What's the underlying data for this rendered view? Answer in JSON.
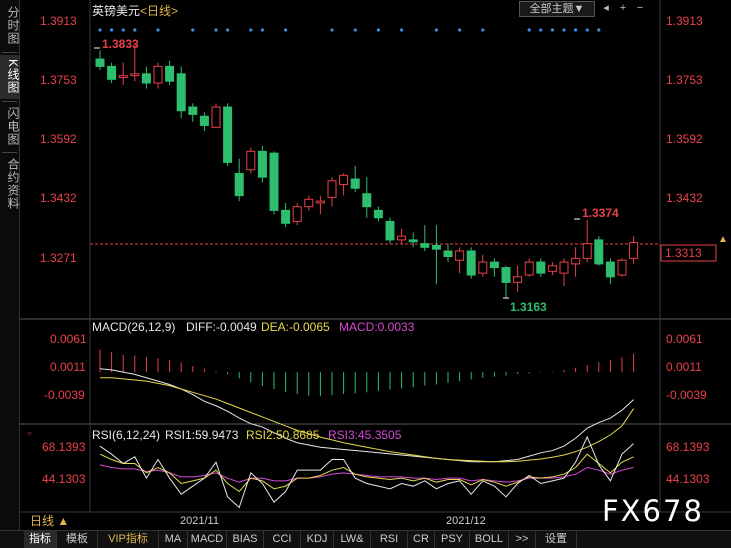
{
  "sidebar": {
    "tabs": [
      {
        "label": "分时图",
        "active": false
      },
      {
        "label": "K线图",
        "active": true
      },
      {
        "label": "闪电图",
        "active": false
      },
      {
        "label": "合约资料",
        "active": false
      }
    ]
  },
  "topbar": {
    "symbol": "英镑美元",
    "period": "<日线>",
    "theme_label": "全部主题▼",
    "icons": [
      "back-icon",
      "plus-icon",
      "minus-icon"
    ]
  },
  "price_panel": {
    "axis_labels": [
      "1.3913",
      "1.3753",
      "1.3592",
      "1.3432",
      "1.3271"
    ],
    "last_price": "1.3313",
    "high_label": "1.3833",
    "low_label": "1.3163",
    "local_high_label": "1.3374"
  },
  "macd_panel": {
    "title": "MACD(26,12,9)",
    "diff_label": "DIFF:-0.0049",
    "dea_label": "DEA:-0.0065",
    "macd_label": "MACD:0.0033",
    "axis_labels": [
      "0.0061",
      "0.0011",
      "-0.0039"
    ]
  },
  "rsi_panel": {
    "title": "RSI(6,12,24)",
    "rsi1_label": "RSI1:59.9473",
    "rsi2_label": "RSI2:50.8685",
    "rsi3_label": "RSI3:45.3505",
    "axis_labels": [
      "68.1393",
      "44.1303"
    ]
  },
  "time_labels": [
    "2021/11",
    "2021/12"
  ],
  "period_button": "日线 ▲",
  "bottom_tabs": [
    {
      "label": "指标",
      "active": true
    },
    {
      "label": "模板",
      "active": false
    },
    {
      "label": "VIP指标",
      "active": false,
      "vip": true
    },
    {
      "label": "MA"
    },
    {
      "label": "MACD"
    },
    {
      "label": "BIAS"
    },
    {
      "label": "CCI"
    },
    {
      "label": "KDJ"
    },
    {
      "label": "LW&"
    },
    {
      "label": "RSI"
    },
    {
      "label": "CR"
    },
    {
      "label": "PSY"
    },
    {
      "label": "BOLL"
    },
    {
      "label": ">>"
    },
    {
      "label": "设置"
    }
  ],
  "watermark": "FX678",
  "colors": {
    "up": "#e8414a",
    "down": "#2dbf6e",
    "diff": "#e8e8e8",
    "dea": "#e6d94a",
    "macd": "#d64ad6",
    "dash": "#e8414a"
  },
  "chart_data": {
    "type": "candlestick",
    "title": "英镑美元 <日线>",
    "ylim": [
      1.3163,
      1.3913
    ],
    "candles": [
      {
        "o": 1.381,
        "h": 1.3833,
        "l": 1.378,
        "c": 1.379
      },
      {
        "o": 1.379,
        "h": 1.38,
        "l": 1.3745,
        "c": 1.3755
      },
      {
        "o": 1.376,
        "h": 1.38,
        "l": 1.374,
        "c": 1.3765
      },
      {
        "o": 1.3765,
        "h": 1.385,
        "l": 1.375,
        "c": 1.377
      },
      {
        "o": 1.377,
        "h": 1.379,
        "l": 1.373,
        "c": 1.3745
      },
      {
        "o": 1.3745,
        "h": 1.38,
        "l": 1.373,
        "c": 1.379
      },
      {
        "o": 1.379,
        "h": 1.3805,
        "l": 1.374,
        "c": 1.375
      },
      {
        "o": 1.377,
        "h": 1.379,
        "l": 1.365,
        "c": 1.367
      },
      {
        "o": 1.368,
        "h": 1.369,
        "l": 1.364,
        "c": 1.366
      },
      {
        "o": 1.3655,
        "h": 1.3665,
        "l": 1.3615,
        "c": 1.363
      },
      {
        "o": 1.3625,
        "h": 1.369,
        "l": 1.3625,
        "c": 1.368
      },
      {
        "o": 1.368,
        "h": 1.369,
        "l": 1.352,
        "c": 1.353
      },
      {
        "o": 1.35,
        "h": 1.354,
        "l": 1.3425,
        "c": 1.344
      },
      {
        "o": 1.351,
        "h": 1.357,
        "l": 1.35,
        "c": 1.356
      },
      {
        "o": 1.356,
        "h": 1.3575,
        "l": 1.3475,
        "c": 1.349
      },
      {
        "o": 1.3555,
        "h": 1.356,
        "l": 1.339,
        "c": 1.34
      },
      {
        "o": 1.34,
        "h": 1.342,
        "l": 1.3355,
        "c": 1.3365
      },
      {
        "o": 1.337,
        "h": 1.342,
        "l": 1.336,
        "c": 1.341
      },
      {
        "o": 1.341,
        "h": 1.344,
        "l": 1.34,
        "c": 1.343
      },
      {
        "o": 1.342,
        "h": 1.344,
        "l": 1.339,
        "c": 1.3425
      },
      {
        "o": 1.3435,
        "h": 1.349,
        "l": 1.341,
        "c": 1.348
      },
      {
        "o": 1.347,
        "h": 1.35,
        "l": 1.344,
        "c": 1.3495
      },
      {
        "o": 1.3485,
        "h": 1.352,
        "l": 1.345,
        "c": 1.346
      },
      {
        "o": 1.3445,
        "h": 1.349,
        "l": 1.338,
        "c": 1.341
      },
      {
        "o": 1.34,
        "h": 1.341,
        "l": 1.337,
        "c": 1.338
      },
      {
        "o": 1.337,
        "h": 1.338,
        "l": 1.331,
        "c": 1.332
      },
      {
        "o": 1.332,
        "h": 1.335,
        "l": 1.331,
        "c": 1.333
      },
      {
        "o": 1.332,
        "h": 1.334,
        "l": 1.33,
        "c": 1.3315
      },
      {
        "o": 1.331,
        "h": 1.336,
        "l": 1.329,
        "c": 1.33
      },
      {
        "o": 1.3305,
        "h": 1.336,
        "l": 1.32,
        "c": 1.3295
      },
      {
        "o": 1.329,
        "h": 1.331,
        "l": 1.326,
        "c": 1.3275
      },
      {
        "o": 1.3265,
        "h": 1.33,
        "l": 1.323,
        "c": 1.329
      },
      {
        "o": 1.329,
        "h": 1.33,
        "l": 1.3215,
        "c": 1.3225
      },
      {
        "o": 1.323,
        "h": 1.328,
        "l": 1.322,
        "c": 1.326
      },
      {
        "o": 1.326,
        "h": 1.327,
        "l": 1.322,
        "c": 1.3245
      },
      {
        "o": 1.3245,
        "h": 1.325,
        "l": 1.3163,
        "c": 1.3205
      },
      {
        "o": 1.3205,
        "h": 1.325,
        "l": 1.318,
        "c": 1.322
      },
      {
        "o": 1.3225,
        "h": 1.327,
        "l": 1.322,
        "c": 1.326
      },
      {
        "o": 1.326,
        "h": 1.327,
        "l": 1.322,
        "c": 1.323
      },
      {
        "o": 1.3235,
        "h": 1.326,
        "l": 1.3225,
        "c": 1.325
      },
      {
        "o": 1.323,
        "h": 1.327,
        "l": 1.3195,
        "c": 1.326
      },
      {
        "o": 1.3255,
        "h": 1.33,
        "l": 1.322,
        "c": 1.327
      },
      {
        "o": 1.327,
        "h": 1.3374,
        "l": 1.326,
        "c": 1.331
      },
      {
        "o": 1.332,
        "h": 1.333,
        "l": 1.325,
        "c": 1.3255
      },
      {
        "o": 1.326,
        "h": 1.327,
        "l": 1.32,
        "c": 1.322
      },
      {
        "o": 1.3225,
        "h": 1.327,
        "l": 1.322,
        "c": 1.3265
      },
      {
        "o": 1.327,
        "h": 1.333,
        "l": 1.3255,
        "c": 1.3313
      }
    ],
    "dots_top": [
      0,
      1,
      2,
      3,
      5,
      8,
      10,
      11,
      13,
      14,
      16,
      20,
      22,
      24,
      26,
      29,
      31,
      33,
      37,
      38,
      39,
      40,
      41,
      42,
      43
    ],
    "macd_hist": [
      0.004,
      0.0036,
      0.0031,
      0.003,
      0.0027,
      0.0025,
      0.0022,
      0.0017,
      0.0011,
      0.0006,
      0.0002,
      -0.0004,
      -0.0011,
      -0.0018,
      -0.0025,
      -0.003,
      -0.0035,
      -0.0039,
      -0.0042,
      -0.0043,
      -0.0041,
      -0.0039,
      -0.0038,
      -0.0036,
      -0.0033,
      -0.0031,
      -0.0029,
      -0.0027,
      -0.0024,
      -0.0022,
      -0.0019,
      -0.0016,
      -0.0013,
      -0.001,
      -0.0008,
      -0.0006,
      -0.0003,
      -0.0002,
      -0.0001,
      0.0001,
      0.0004,
      0.0008,
      0.0013,
      0.0018,
      0.0022,
      0.0026,
      0.0033
    ],
    "macd_diff": [
      0.0006,
      0.0004,
      0.0,
      -0.0004,
      -0.001,
      -0.0016,
      -0.0022,
      -0.003,
      -0.004,
      -0.0052,
      -0.006,
      -0.007,
      -0.0082,
      -0.0092,
      -0.0098,
      -0.0108,
      -0.0118,
      -0.0126,
      -0.013,
      -0.0134,
      -0.0136,
      -0.0138,
      -0.014,
      -0.0142,
      -0.0144,
      -0.0146,
      -0.0148,
      -0.015,
      -0.0152,
      -0.0154,
      -0.0156,
      -0.0158,
      -0.016,
      -0.016,
      -0.016,
      -0.0158,
      -0.0156,
      -0.015,
      -0.0144,
      -0.014,
      -0.0132,
      -0.0118,
      -0.01,
      -0.009,
      -0.0082,
      -0.0068,
      -0.0049
    ],
    "macd_dea": [
      -0.001,
      -0.001,
      -0.0012,
      -0.0014,
      -0.0016,
      -0.002,
      -0.0024,
      -0.003,
      -0.0036,
      -0.0042,
      -0.0048,
      -0.0056,
      -0.0064,
      -0.0072,
      -0.008,
      -0.0088,
      -0.0096,
      -0.0104,
      -0.011,
      -0.0116,
      -0.0121,
      -0.0126,
      -0.013,
      -0.0134,
      -0.0138,
      -0.0142,
      -0.0145,
      -0.0148,
      -0.0151,
      -0.0154,
      -0.0156,
      -0.0157,
      -0.0158,
      -0.0159,
      -0.016,
      -0.016,
      -0.0159,
      -0.0157,
      -0.0155,
      -0.0152,
      -0.0148,
      -0.0142,
      -0.0134,
      -0.0124,
      -0.0112,
      -0.0096,
      -0.0065
    ],
    "macd_ylim": [
      -0.0165,
      0.0061
    ],
    "rsi1": [
      68,
      62,
      55,
      60,
      44,
      58,
      44,
      32,
      38,
      44,
      56,
      30,
      22,
      48,
      40,
      26,
      34,
      50,
      50,
      50,
      58,
      58,
      44,
      40,
      38,
      36,
      40,
      38,
      42,
      36,
      40,
      42,
      32,
      42,
      38,
      30,
      40,
      46,
      40,
      42,
      44,
      56,
      75,
      54,
      42,
      62,
      70
    ],
    "rsi2": [
      62,
      58,
      55,
      55,
      48,
      52,
      48,
      40,
      42,
      44,
      50,
      40,
      34,
      44,
      42,
      36,
      38,
      44,
      44,
      46,
      50,
      52,
      47,
      45,
      44,
      43,
      44,
      42,
      44,
      41,
      43,
      43,
      39,
      43,
      41,
      38,
      41,
      45,
      44,
      45,
      47,
      52,
      62,
      55,
      48,
      56,
      60
    ],
    "rsi3": [
      54,
      52,
      51,
      51,
      49,
      50,
      48,
      45,
      45,
      46,
      48,
      44,
      41,
      44,
      44,
      42,
      42,
      44,
      44,
      45,
      47,
      48,
      47,
      46,
      45,
      45,
      45,
      44,
      44,
      43,
      44,
      44,
      42,
      43,
      42,
      41,
      42,
      44,
      44,
      44,
      45,
      47,
      52,
      50,
      47,
      50,
      52
    ],
    "rsi_ylim": [
      20,
      80
    ]
  }
}
